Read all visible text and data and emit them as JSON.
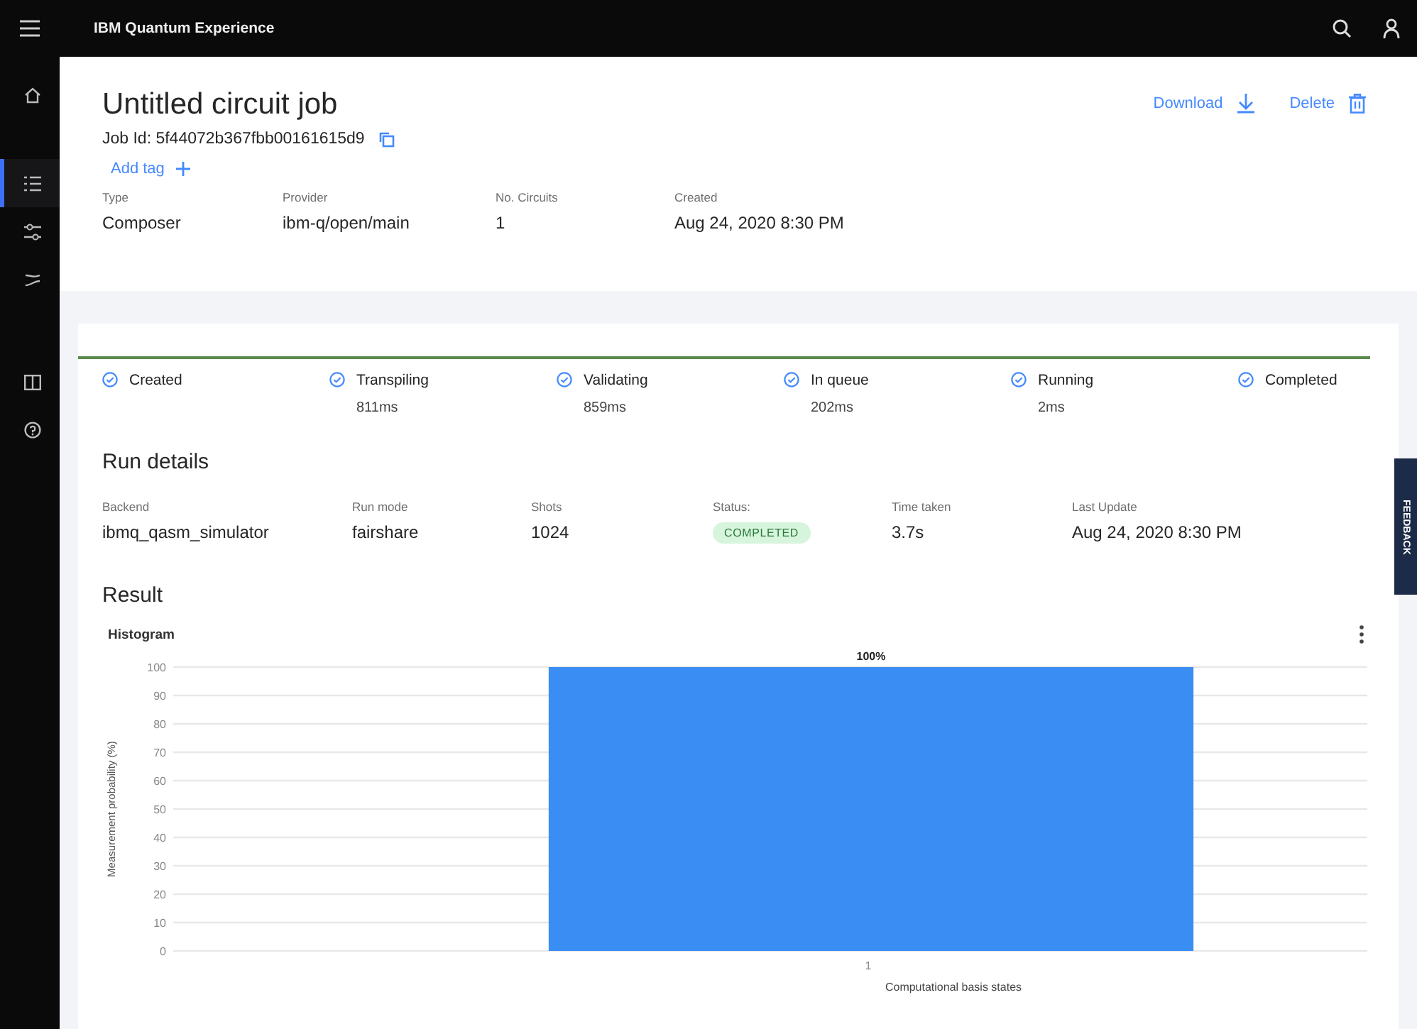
{
  "app": {
    "title": "IBM Quantum Experience"
  },
  "sidebar": {
    "items": [
      {
        "selected": false
      },
      {
        "selected": true
      },
      {
        "selected": false
      },
      {
        "selected": false
      },
      {
        "selected": false
      },
      {
        "selected": false
      }
    ]
  },
  "job": {
    "title": "Untitled circuit job",
    "job_id": "Job Id: 5f44072b367fbb00161615d9",
    "add_tag": "Add tag",
    "actions": [
      {
        "label": "Download"
      },
      {
        "label": "Delete"
      }
    ],
    "meta": [
      {
        "label": "Type",
        "value": "Composer"
      },
      {
        "label": "Provider",
        "value": "ibm-q/open/main"
      },
      {
        "label": "No. Circuits",
        "value": "1"
      },
      {
        "label": "Created",
        "value": "Aug 24, 2020 8:30 PM"
      }
    ]
  },
  "pipeline": [
    {
      "name": "Created"
    },
    {
      "name": "Transpiling",
      "duration": "811ms"
    },
    {
      "name": "Validating",
      "duration": "859ms"
    },
    {
      "name": "In queue",
      "duration": "202ms"
    },
    {
      "name": "Running",
      "duration": "2ms"
    },
    {
      "name": "Completed"
    }
  ],
  "run_details": {
    "title": "Run details",
    "fields": [
      {
        "label": "Backend",
        "value": "ibmq_qasm_simulator",
        "kind": "text"
      },
      {
        "label": "Run mode",
        "value": "fairshare",
        "kind": "text"
      },
      {
        "label": "Shots",
        "value": "1024",
        "kind": "text"
      },
      {
        "label": "Status:",
        "value": "COMPLETED",
        "kind": "badge"
      },
      {
        "label": "Time taken",
        "value": "3.7s",
        "kind": "text"
      },
      {
        "label": "Last Update",
        "value": "Aug 24, 2020 8:30 PM",
        "kind": "text"
      }
    ]
  },
  "result": {
    "title": "Result",
    "histogram": {
      "chart_data": {
        "type": "bar",
        "title": "Histogram",
        "xlabel": "Computational basis states",
        "ylabel": "Measurement probability (%)",
        "categories": [
          "1"
        ],
        "values": [
          100
        ],
        "ylim": [
          0,
          100
        ],
        "yticks": [
          0,
          10,
          20,
          30,
          40,
          50,
          60,
          70,
          80,
          90,
          100
        ],
        "value_labels": [
          "100%"
        ],
        "grid": true
      }
    }
  },
  "feedback": {
    "label": "FEEDBACK"
  }
}
